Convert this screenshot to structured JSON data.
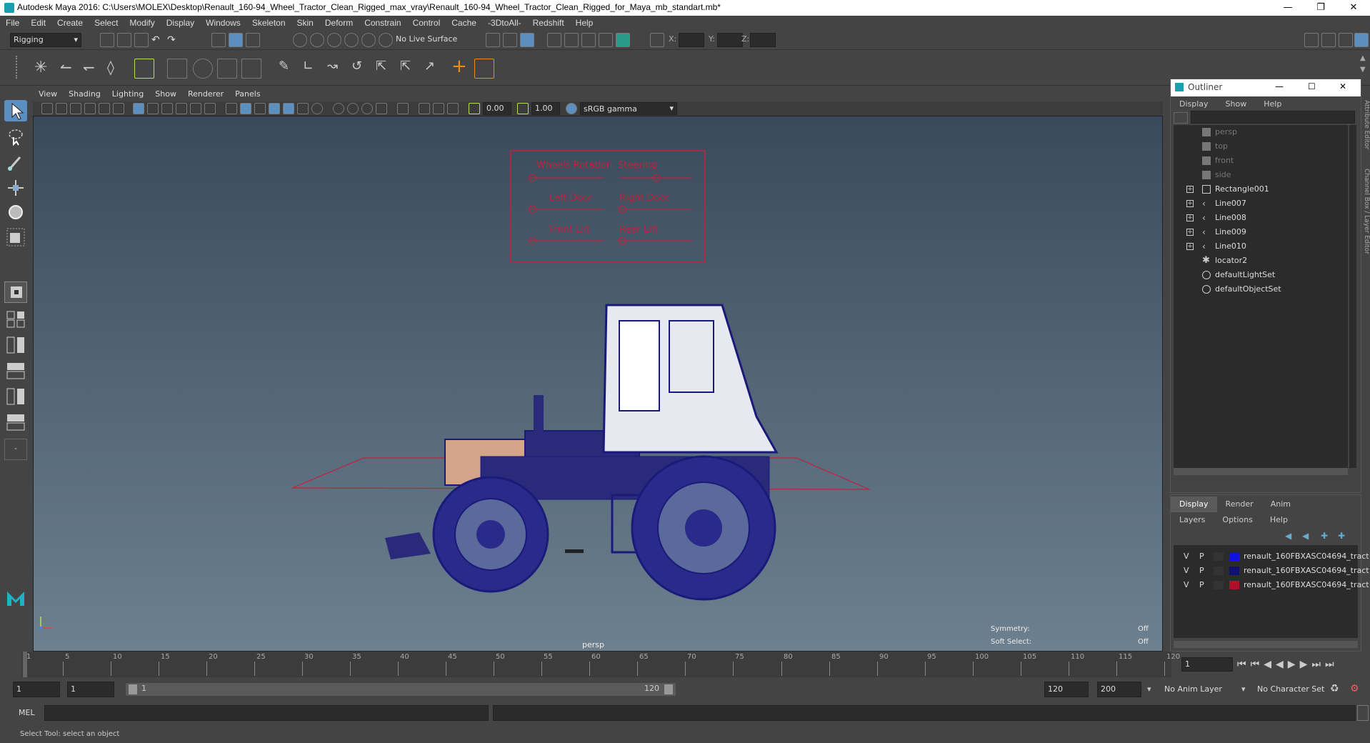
{
  "window": {
    "title": "Autodesk Maya 2016: C:\\Users\\MOLEX\\Desktop\\Renault_160-94_Wheel_Tractor_Clean_Rigged_max_vray\\Renault_160-94_Wheel_Tractor_Clean_Rigged_for_Maya_mb_standart.mb*"
  },
  "menubar": [
    "File",
    "Edit",
    "Create",
    "Select",
    "Modify",
    "Display",
    "Windows",
    "Skeleton",
    "Skin",
    "Deform",
    "Constrain",
    "Control",
    "Cache",
    "-3DtoAll-",
    "Redshift",
    "Help"
  ],
  "statusline": {
    "menuset": "Rigging",
    "live_surface": "No Live Surface",
    "x_label": "X:",
    "y_label": "Y:",
    "z_label": "Z:"
  },
  "viewport": {
    "menu": [
      "View",
      "Shading",
      "Lighting",
      "Show",
      "Renderer",
      "Panels"
    ],
    "exposure": "0.00",
    "gamma": "1.00",
    "color_space": "sRGB gamma",
    "camera_label": "persp",
    "symmetry_label": "Symmetry:",
    "symmetry_value": "Off",
    "soft_select_label": "Soft Select:",
    "soft_select_value": "Off",
    "rig_panel": {
      "controls": [
        "Wheels Rotation",
        "Steering",
        "Left Door",
        "Right Door",
        "Front Lift",
        "Rear Lift"
      ]
    },
    "colors": {
      "rig": "#c0223b",
      "wire": "#1a1a7a"
    }
  },
  "outliner": {
    "title": "Outliner",
    "menu": [
      "Display",
      "Show",
      "Help"
    ],
    "items": [
      {
        "label": "persp",
        "icon": "camera-icon",
        "expandable": false,
        "dim": true
      },
      {
        "label": "top",
        "icon": "camera-icon",
        "expandable": false,
        "dim": true
      },
      {
        "label": "front",
        "icon": "camera-icon",
        "expandable": false,
        "dim": true
      },
      {
        "label": "side",
        "icon": "camera-icon",
        "expandable": false,
        "dim": true
      },
      {
        "label": "Rectangle001",
        "icon": "curve-group-icon",
        "expandable": true,
        "dim": false
      },
      {
        "label": "Line007",
        "icon": "curve-icon",
        "expandable": true,
        "dim": false
      },
      {
        "label": "Line008",
        "icon": "curve-icon",
        "expandable": true,
        "dim": false
      },
      {
        "label": "Line009",
        "icon": "curve-icon",
        "expandable": true,
        "dim": false
      },
      {
        "label": "Line010",
        "icon": "curve-icon",
        "expandable": true,
        "dim": false
      },
      {
        "label": "locator2",
        "icon": "locator-icon",
        "expandable": false,
        "dim": false
      },
      {
        "label": "defaultLightSet",
        "icon": "set-icon",
        "expandable": false,
        "dim": false
      },
      {
        "label": "defaultObjectSet",
        "icon": "set-icon",
        "expandable": false,
        "dim": false
      }
    ]
  },
  "layer_editor": {
    "tabs": [
      "Display",
      "Render",
      "Anim"
    ],
    "menu": [
      "Layers",
      "Options",
      "Help"
    ],
    "layers": [
      {
        "v": "V",
        "p": "P",
        "color": "#1010e0",
        "name": "renault_160FBXASC04694_tract"
      },
      {
        "v": "V",
        "p": "P",
        "color": "#101070",
        "name": "renault_160FBXASC04694_tract"
      },
      {
        "v": "V",
        "p": "P",
        "color": "#b0102a",
        "name": "renault_160FBXASC04694_tract"
      }
    ]
  },
  "side_tabs": "Channel Box / Layer Editor",
  "side_tabs_top": "Attribute Editor",
  "timeline": {
    "ticks": [
      "1",
      "5",
      "10",
      "15",
      "20",
      "25",
      "30",
      "35",
      "40",
      "45",
      "50",
      "55",
      "60",
      "65",
      "70",
      "75",
      "80",
      "85",
      "90",
      "95",
      "100",
      "105",
      "110",
      "115",
      "120"
    ],
    "current_frame": "1"
  },
  "range": {
    "start": "1",
    "playback_start": "1",
    "slider_start": "1",
    "slider_end": "120",
    "playback_end": "120",
    "end": "200",
    "anim_layer": "No Anim Layer",
    "character_set": "No Character Set"
  },
  "command_line": {
    "label": "MEL"
  },
  "help_line": "Select Tool: select an object"
}
